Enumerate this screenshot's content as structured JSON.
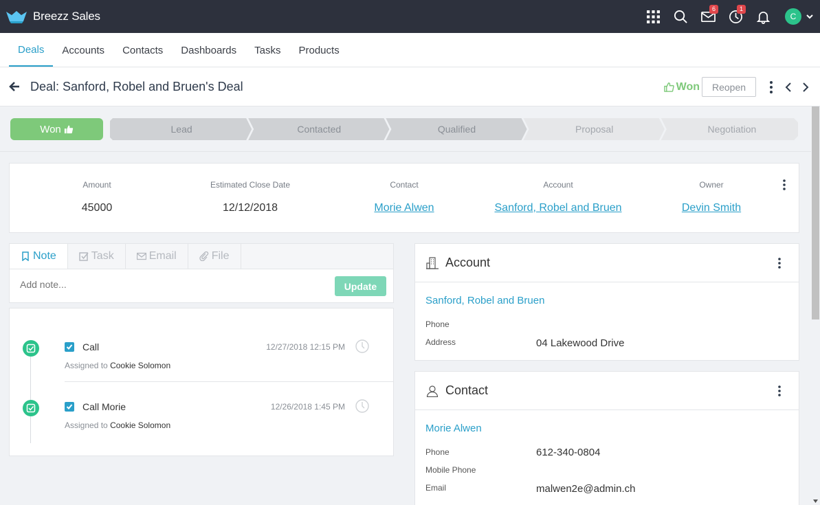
{
  "app": {
    "title": "Breezz Sales",
    "mail_badge": "6",
    "activity_badge": "1",
    "avatar_letter": "C"
  },
  "nav": {
    "tabs": [
      {
        "label": "Deals",
        "active": true
      },
      {
        "label": "Accounts",
        "active": false
      },
      {
        "label": "Contacts",
        "active": false
      },
      {
        "label": "Dashboards",
        "active": false
      },
      {
        "label": "Tasks",
        "active": false
      },
      {
        "label": "Products",
        "active": false
      }
    ]
  },
  "header": {
    "title": "Deal: Sanford, Robel and Bruen's Deal",
    "status": "Won",
    "reopen_label": "Reopen"
  },
  "pipeline": {
    "won_label": "Won",
    "stages": [
      {
        "label": "Lead",
        "reached": true
      },
      {
        "label": "Contacted",
        "reached": true
      },
      {
        "label": "Qualified",
        "reached": true
      },
      {
        "label": "Proposal",
        "reached": false
      },
      {
        "label": "Negotiation",
        "reached": false
      }
    ]
  },
  "summary": {
    "amount_label": "Amount",
    "amount": "45000",
    "close_date_label": "Estimated Close Date",
    "close_date": "12/12/2018",
    "contact_label": "Contact",
    "contact": "Morie Alwen",
    "account_label": "Account",
    "account": "Sanford, Robel and Bruen",
    "owner_label": "Owner",
    "owner": "Devin Smith"
  },
  "activity": {
    "tabs": [
      "Note",
      "Task",
      "Email",
      "File"
    ],
    "note_placeholder": "Add note...",
    "update_label": "Update"
  },
  "timeline": {
    "items": [
      {
        "title": "Call",
        "date": "12/27/2018 12:15 PM",
        "assigned_prefix": "Assigned to",
        "assignee": "Cookie Solomon"
      },
      {
        "title": "Call Morie",
        "date": "12/26/2018 1:45 PM",
        "assigned_prefix": "Assigned to",
        "assignee": "Cookie Solomon"
      }
    ]
  },
  "account_card": {
    "title": "Account",
    "name": "Sanford, Robel and Bruen",
    "phone_label": "Phone",
    "phone": "",
    "address_label": "Address",
    "address": "04 Lakewood Drive"
  },
  "contact_card": {
    "title": "Contact",
    "name": "Morie Alwen",
    "phone_label": "Phone",
    "phone": "612-340-0804",
    "mobile_label": "Mobile Phone",
    "mobile": "",
    "email_label": "Email",
    "email": "malwen2e@admin.ch"
  },
  "colors": {
    "topbar": "#2d313d",
    "accent": "#2a9fc9",
    "won_green": "#7ec97a",
    "timeline_green": "#2cc38b",
    "badge_red": "#e0474c",
    "stage_reached": "#cfd1d4",
    "stage_pending": "#e6e7e9"
  },
  "icons": [
    "logo-icon",
    "apps-grid-icon",
    "search-icon",
    "mail-icon",
    "history-icon",
    "bell-icon",
    "back-arrow-icon",
    "thumbs-up-icon",
    "kebab-icon",
    "chevron-left-icon",
    "chevron-right-icon",
    "bookmark-icon",
    "checkbox-icon",
    "envelope-icon",
    "paperclip-icon",
    "clock-icon",
    "building-icon",
    "user-icon"
  ]
}
